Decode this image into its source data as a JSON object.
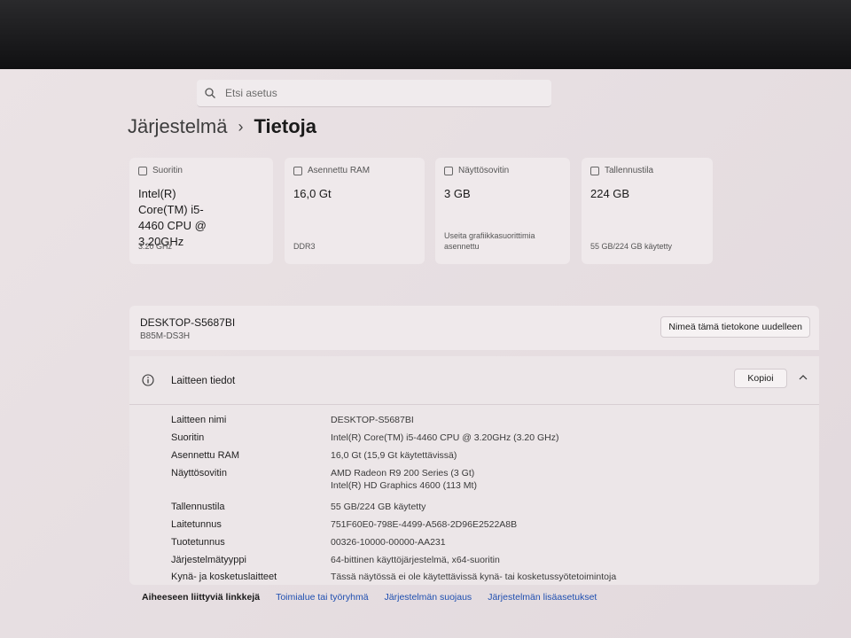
{
  "search": {
    "placeholder": "Etsi asetus"
  },
  "breadcrumb": {
    "parent": "Järjestelmä",
    "separator": "›",
    "current": "Tietoja"
  },
  "cards": [
    {
      "title": "Suoritin",
      "value": "Intel(R) Core(TM) i5-4460  CPU @ 3.20GHz",
      "sub": "3.20 GHz"
    },
    {
      "title": "Asennettu RAM",
      "value": "16,0 Gt",
      "sub": "DDR3"
    },
    {
      "title": "Näyttösovitin",
      "value": "3 GB",
      "sub": "Useita grafiikkasuorittimia asennettu"
    },
    {
      "title": "Tallennustila",
      "value": "224 GB",
      "sub": "55 GB/224 GB käytetty"
    }
  ],
  "device": {
    "name": "DESKTOP-S5687BI",
    "model": "B85M-DS3H",
    "rename_label": "Nimeä tämä tietokone uudelleen"
  },
  "specs": {
    "title": "Laitteen tiedot",
    "copy_label": "Kopioi",
    "rows": [
      {
        "key": "Laitteen nimi",
        "value": "DESKTOP-S5687BI"
      },
      {
        "key": "Suoritin",
        "value": "Intel(R) Core(TM) i5-4460 CPU @ 3.20GHz (3.20 GHz)"
      },
      {
        "key": "Asennettu RAM",
        "value": "16,0 Gt (15,9 Gt käytettävissä)"
      },
      {
        "key": "Näyttösovitin",
        "value": "AMD Radeon R9 200 Series (3 Gt)",
        "value2": "Intel(R) HD Graphics 4600 (113 Mt)"
      },
      {
        "key": "Tallennustila",
        "value": "55 GB/224 GB käytetty"
      },
      {
        "key": "Laitetunnus",
        "value": "751F60E0-798E-4499-A568-2D96E2522A8B"
      },
      {
        "key": "Tuotetunnus",
        "value": "00326-10000-00000-AA231"
      },
      {
        "key": "Järjestelmätyyppi",
        "value": "64-bittinen käyttöjärjestelmä, x64-suoritin"
      },
      {
        "key": "Kynä- ja kosketuslaitteet",
        "value": "Tässä näytössä ei ole käytettävissä kynä- tai kosketussyötetoimintoja"
      }
    ]
  },
  "related": {
    "label": "Aiheeseen liittyviä linkkejä",
    "links": [
      "Toimialue tai työryhmä",
      "Järjestelmän suojaus",
      "Järjestelmän lisäasetukset"
    ]
  }
}
